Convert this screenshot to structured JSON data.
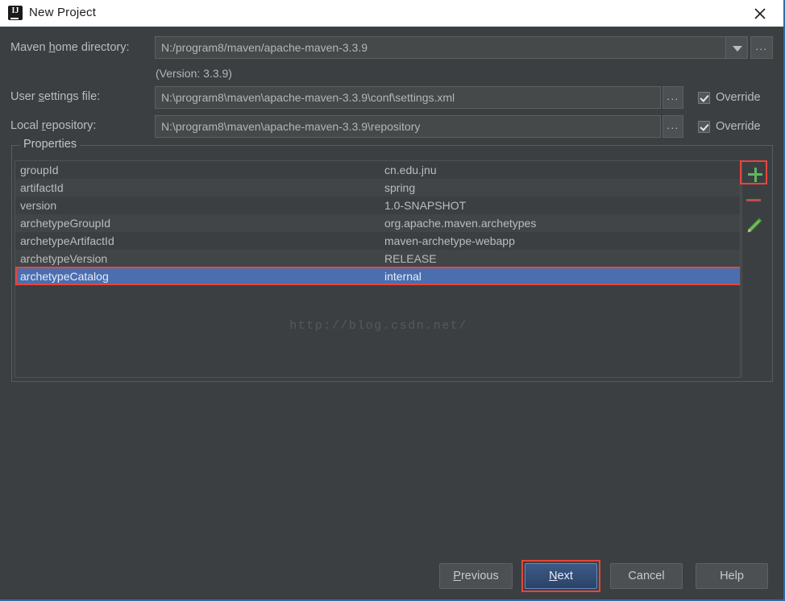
{
  "window": {
    "title": "New Project",
    "icon": "intellij-idea-icon",
    "close_icon": "close-icon"
  },
  "form": {
    "maven_home": {
      "label_pre": "Maven ",
      "label_mnemonic": "h",
      "label_post": "ome directory:",
      "value": "N:/program8/maven/apache-maven-3.3.9",
      "dropdown_icon": "chevron-down-icon",
      "browse_label": "...",
      "version_note": "(Version: 3.3.9)"
    },
    "user_settings": {
      "label_pre": "User ",
      "label_mnemonic": "s",
      "label_post": "ettings file:",
      "value": "N:\\program8\\maven\\apache-maven-3.3.9\\conf\\settings.xml",
      "browse_label": "...",
      "override_label": "Override",
      "override_checked": true
    },
    "local_repository": {
      "label_pre": "Local ",
      "label_mnemonic": "r",
      "label_post": "epository:",
      "value": "N:\\program8\\maven\\apache-maven-3.3.9\\repository",
      "browse_label": "...",
      "override_label": "Override",
      "override_checked": true
    }
  },
  "properties": {
    "group_title": "Properties",
    "rows": [
      {
        "key": "groupId",
        "value": "cn.edu.jnu",
        "selected": false
      },
      {
        "key": "artifactId",
        "value": "spring",
        "selected": false
      },
      {
        "key": "version",
        "value": "1.0-SNAPSHOT",
        "selected": false
      },
      {
        "key": "archetypeGroupId",
        "value": "org.apache.maven.archetypes",
        "selected": false
      },
      {
        "key": "archetypeArtifactId",
        "value": "maven-archetype-webapp",
        "selected": false
      },
      {
        "key": "archetypeVersion",
        "value": "RELEASE",
        "selected": false
      },
      {
        "key": "archetypeCatalog",
        "value": "internal",
        "selected": true
      }
    ],
    "watermark": "http://blog.csdn.net/",
    "toolbar": {
      "add": {
        "name": "add-property-button",
        "icon": "plus-icon",
        "highlighted": true
      },
      "remove": {
        "name": "remove-property-button",
        "icon": "minus-icon",
        "highlighted": false
      },
      "edit": {
        "name": "edit-property-button",
        "icon": "pencil-icon",
        "highlighted": false
      }
    }
  },
  "footer": {
    "previous": {
      "pre": "",
      "mnemonic": "P",
      "post": "revious"
    },
    "next": {
      "pre": "",
      "mnemonic": "N",
      "post": "ext",
      "primary": true,
      "highlighted": true
    },
    "cancel": {
      "label": "Cancel"
    },
    "help": {
      "label": "Help"
    }
  },
  "colors": {
    "window_bg": "#3c3f41",
    "titlebar_bg": "#ffffff",
    "accent_selection": "#4b6eaf",
    "annotation_red": "#e8453c",
    "plus_green": "#5cb85c",
    "minus_red": "#b5524b",
    "border_blue": "#2d6ca8"
  }
}
